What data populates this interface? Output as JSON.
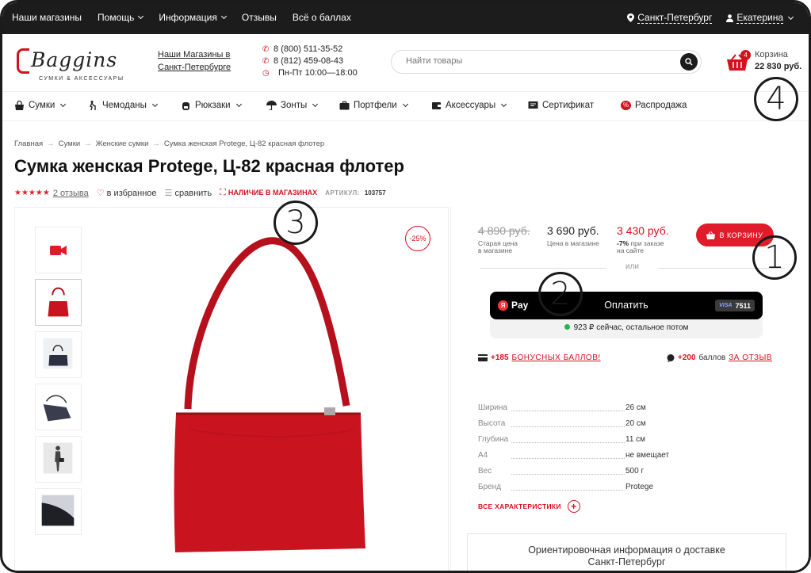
{
  "topbar": {
    "nav": [
      {
        "label": "Наши магазины",
        "chevron": false
      },
      {
        "label": "Помощь",
        "chevron": true
      },
      {
        "label": "Информация",
        "chevron": true
      },
      {
        "label": "Отзывы",
        "chevron": false
      },
      {
        "label": "Всё о баллах",
        "chevron": false
      }
    ],
    "city": "Санкт-Петербург",
    "user": "Екатерина"
  },
  "header": {
    "logo_text": "Baggins",
    "logo_sub": "СУМКИ & АКСЕССУАРЫ",
    "stores_link_line1": "Наши Магазины в",
    "stores_link_line2": "Санкт-Петербурге",
    "phone1": "8 (800) 511-35-52",
    "phone2": "8 (812) 459-08-43",
    "hours": "Пн-Пт 10:00—18:00",
    "search_placeholder": "Найти товары",
    "cart_label": "Корзина",
    "cart_total": "22 830 руб.",
    "cart_count": "4"
  },
  "categories": [
    {
      "label": "Сумки",
      "icon": "bag-icon",
      "chevron": true
    },
    {
      "label": "Чемоданы",
      "icon": "traveler-icon",
      "chevron": true
    },
    {
      "label": "Рюкзаки",
      "icon": "backpack-icon",
      "chevron": true
    },
    {
      "label": "Зонты",
      "icon": "umbrella-icon",
      "chevron": true
    },
    {
      "label": "Портфели",
      "icon": "briefcase-icon",
      "chevron": true
    },
    {
      "label": "Аксессуары",
      "icon": "wallet-icon",
      "chevron": true
    },
    {
      "label": "Сертификат",
      "icon": "certificate-icon",
      "chevron": false
    },
    {
      "label": "Распродажа",
      "icon": "sale-icon",
      "chevron": false
    }
  ],
  "breadcrumbs": [
    "Главная",
    "Сумки",
    "Женские сумки",
    "Сумка женская Protege, Ц-82 красная флотер"
  ],
  "product": {
    "title": "Сумка женская Protege, Ц-82 красная флотер",
    "reviews": "2 отзыва",
    "favorite": "в избранное",
    "compare": "сравнить",
    "in_stores": "НАЛИЧИЕ В МАГАЗИНАХ",
    "article_label": "АРТИКУЛ:",
    "article": "103757",
    "discount": "-25%"
  },
  "pricing": {
    "old_price": "4 890 руб.",
    "old_caption1": "Старая цена",
    "old_caption2": "в магазине",
    "shop_price": "3 690 руб.",
    "shop_caption": "Цена в магазине",
    "site_price": "3 430 руб.",
    "site_caption_pct": "-7%",
    "site_caption1": " при заказе",
    "site_caption2": "на сайте",
    "buy_label": "В КОРЗИНУ",
    "or": "или",
    "pay_brand": "Pay",
    "pay_label": "Оплатить",
    "card_brand": "VISA",
    "card_last": "7511",
    "split_text": "923 ₽ сейчас, остальное потом"
  },
  "bonus": {
    "left_amount": "+185",
    "left_link": "БОНУСНЫХ БАЛЛОВ!",
    "right_amount": "+200",
    "right_text": "баллов",
    "right_link": "ЗА ОТЗЫВ"
  },
  "specs": [
    {
      "k": "Ширина",
      "v": "26 см"
    },
    {
      "k": "Высота",
      "v": "20 см"
    },
    {
      "k": "Глубина",
      "v": "11 см"
    },
    {
      "k": "А4",
      "v": "не вмещает"
    },
    {
      "k": "Вес",
      "v": "500 г"
    },
    {
      "k": "Бренд",
      "v": "Protege"
    }
  ],
  "all_specs": "ВСЕ ХАРАКТЕРИСТИКИ",
  "delivery": {
    "line1": "Ориентировочная информация о доставке",
    "line2": "Санкт-Петербург"
  },
  "annotations": [
    "1",
    "2",
    "3",
    "4"
  ],
  "colors": {
    "accent": "#d4111f",
    "topbar": "#1c1c1c"
  }
}
